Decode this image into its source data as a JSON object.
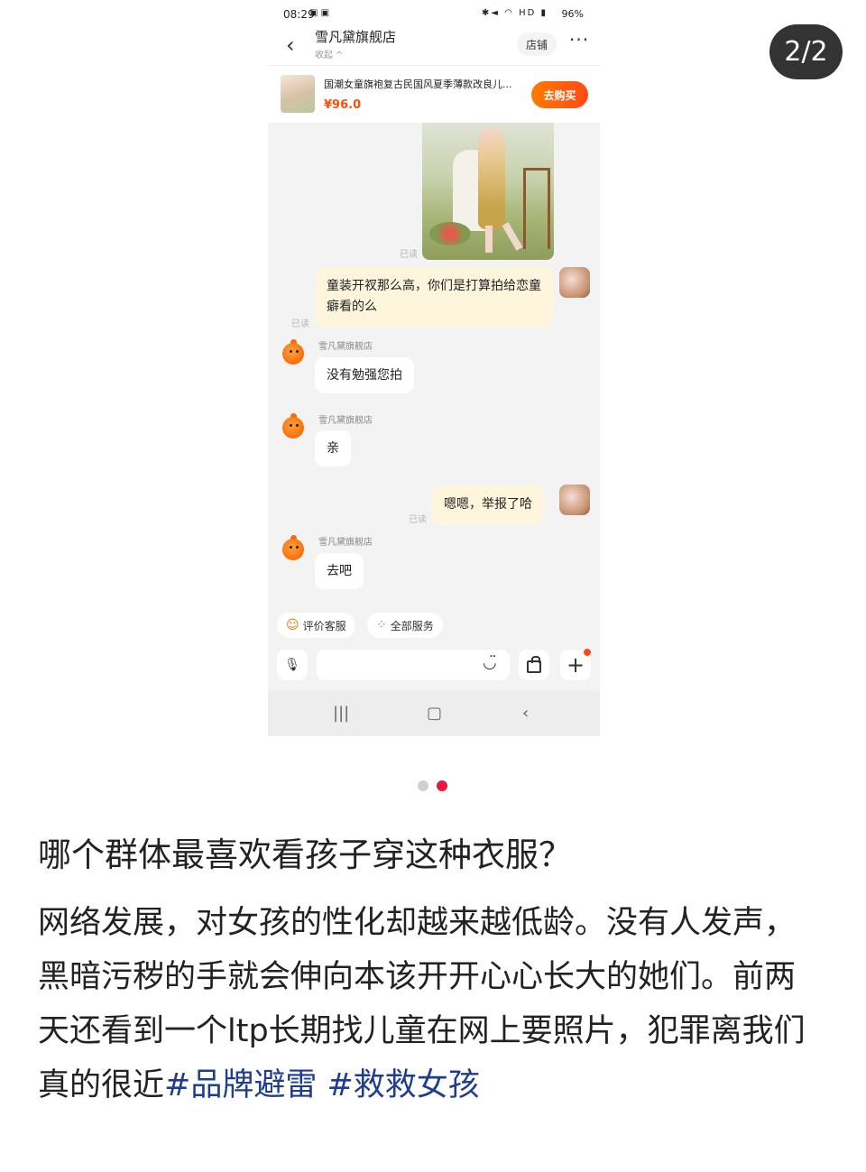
{
  "page_counter": "2/2",
  "status": {
    "time": "08:29",
    "battery": "96%",
    "net": "HD"
  },
  "header": {
    "store_name": "雪凡黛旗舰店",
    "collect": "收起 ^",
    "shop_btn": "店铺",
    "more": "···"
  },
  "product": {
    "title": "国潮女童旗袍复古民国风夏季薄款改良儿...",
    "price": "¥96.0",
    "buy_btn": "去购买"
  },
  "chat": {
    "read_label": "已读",
    "shop_label": "雪凡黛旗舰店",
    "m1": "童装开衩那么高，你们是打算拍给恋童癖看的么",
    "m2": "没有勉强您拍",
    "m3": "亲",
    "m4": "嗯嗯，举报了哈",
    "m5": "去吧"
  },
  "quick": {
    "rate": "评价客服",
    "all": "全部服务"
  },
  "input": {
    "placeholder": ""
  },
  "post": {
    "title": "哪个群体最喜欢看孩子穿这种衣服？",
    "body": "网络发展，对女孩的性化却越来越低龄。没有人发声，黑暗污秽的手就会伸向本该开开心心长大的她们。前两天还看到一个ltp长期找儿童在网上要照片，犯罪离我们真的很近",
    "tag1": "#品牌避雷",
    "tag2": "#救救女孩"
  },
  "colors": {
    "accent": "#ff4a18",
    "tag": "#1f3d8f",
    "out_bubble": "#fff5dd"
  }
}
